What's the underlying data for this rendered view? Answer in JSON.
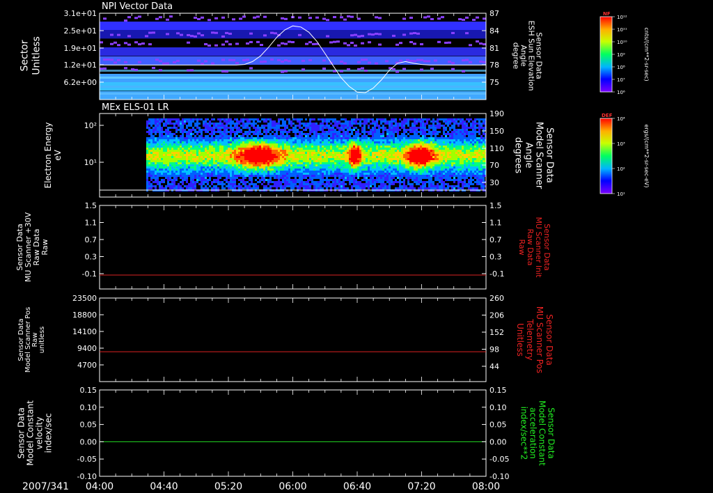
{
  "chart_data": [
    {
      "type": "heatmap",
      "title": "NPI Vector Data",
      "ylabel": "Sector\nUnitless",
      "y_ticks": [
        "3.1e+01",
        "2.5e+01",
        "1.9e+01",
        "1.2e+01",
        "6.2e+00"
      ],
      "y2label": "Sensor Data\nESH Sun Elevation\nAngle\ndegree",
      "y2_ticks": [
        "87",
        "84",
        "81",
        "78",
        "75"
      ],
      "y2lim": [
        72,
        87
      ],
      "overlay_series": {
        "name": "ESH Sun Elevation Angle",
        "color": "#ffffff",
        "x": [
          "04:00",
          "05:00",
          "05:05",
          "05:10",
          "05:15",
          "05:20",
          "05:25",
          "05:30",
          "05:35",
          "05:40",
          "05:45",
          "05:50",
          "05:55",
          "06:00",
          "06:05",
          "06:10",
          "06:15",
          "06:20",
          "06:25",
          "06:30",
          "06:35",
          "06:40",
          "06:45",
          "06:50",
          "06:55",
          "07:00",
          "07:05",
          "07:10",
          "07:15",
          "07:20",
          "07:25",
          "07:30",
          "08:00"
        ],
        "values": [
          78.0,
          78.0,
          78.0,
          78.0,
          78.0,
          78.0,
          78.0,
          78.1,
          78.6,
          79.6,
          81.1,
          82.8,
          84.1,
          84.8,
          84.6,
          83.7,
          82.1,
          80.0,
          77.9,
          75.8,
          74.3,
          73.3,
          73.2,
          74.0,
          75.4,
          77.1,
          78.3,
          78.6,
          78.3,
          78.1,
          78.0,
          78.0,
          78.0
        ]
      },
      "colorbar": {
        "label": "NF",
        "units": "cnts/(cm**2-sr-sec)",
        "ticks": [
          "10¹²",
          "10¹¹",
          "10¹⁰",
          "10⁹",
          "10⁸",
          "10⁷",
          "10⁶"
        ]
      }
    },
    {
      "type": "heatmap",
      "title": "MEx ELS-01 LR",
      "ylabel": "Electron Energy\neV",
      "y_ticks": [
        "10²",
        "10¹"
      ],
      "ylim": [
        1,
        200
      ],
      "y_scale": "log",
      "y2label": "Sensor Data\nModel Scanner\nAngle\ndegrees",
      "y2_ticks": [
        "190",
        "150",
        "110",
        "70",
        "30"
      ],
      "y2lim": [
        10,
        190
      ],
      "overlay_series": {
        "name": "Model Scanner Angle",
        "color": "#ffffff",
        "constant": 12
      },
      "colorbar": {
        "label": "DEF",
        "units": "ergs/(cm**2-sr-sec-eV)",
        "ticks": [
          "10⁴",
          "10³",
          "10²",
          "10¹"
        ]
      }
    },
    {
      "type": "line",
      "ylabel": "Sensor Data\nMU Scanner +30V\nRaw Data\nRaw",
      "y_ticks": [
        "1.5",
        "1.1",
        "0.7",
        "0.3",
        "-0.1"
      ],
      "ylim": [
        -0.3,
        1.5
      ],
      "y2label": "Sensor Data\nMU Scanner Init\nRaw Data\nRaw",
      "y2_ticks": [
        "1.5",
        "1.1",
        "0.7",
        "0.3",
        "-0.1"
      ],
      "series": [
        {
          "color": "#dd2222",
          "constant": 0.0
        }
      ]
    },
    {
      "type": "line",
      "ylabel": "Sensor Data\nModel Scanner Pos\nRaw\nunitless",
      "y_ticks": [
        "23500",
        "18800",
        "14100",
        "9400",
        "4700"
      ],
      "ylim": [
        0,
        23500
      ],
      "y2label": "Sensor Data\nMU Scanner Pos\nTelemetry\nUnitless",
      "y2_ticks": [
        "260",
        "206",
        "152",
        "98",
        "44"
      ],
      "y2lim": [
        -10,
        260
      ],
      "series": [
        {
          "color": "#dd2222",
          "constant": 8400
        }
      ]
    },
    {
      "type": "line",
      "ylabel": "Sensor Data\nModel Constant\nvelocity\nindex/sec",
      "y_ticks": [
        "0.15",
        "0.10",
        "0.05",
        "0.00",
        "-0.05",
        "-0.10"
      ],
      "ylim": [
        -0.1,
        0.15
      ],
      "y2label": "Sensor Data\nModel Constant\nacceleration\nindex/sec**2",
      "y2_ticks": [
        "0.15",
        "0.10",
        "0.05",
        "0.00",
        "-0.05",
        "-0.10"
      ],
      "series": [
        {
          "color": "#22dd22",
          "constant": 0.0
        }
      ]
    }
  ],
  "x_axis": {
    "date": "2007/341",
    "ticks": [
      "04:00",
      "04:40",
      "05:20",
      "06:00",
      "06:40",
      "07:20",
      "08:00"
    ],
    "xlim": [
      "04:00",
      "08:00"
    ]
  },
  "colors": {
    "label_red": "#ee2222",
    "label_green": "#22ee22"
  }
}
